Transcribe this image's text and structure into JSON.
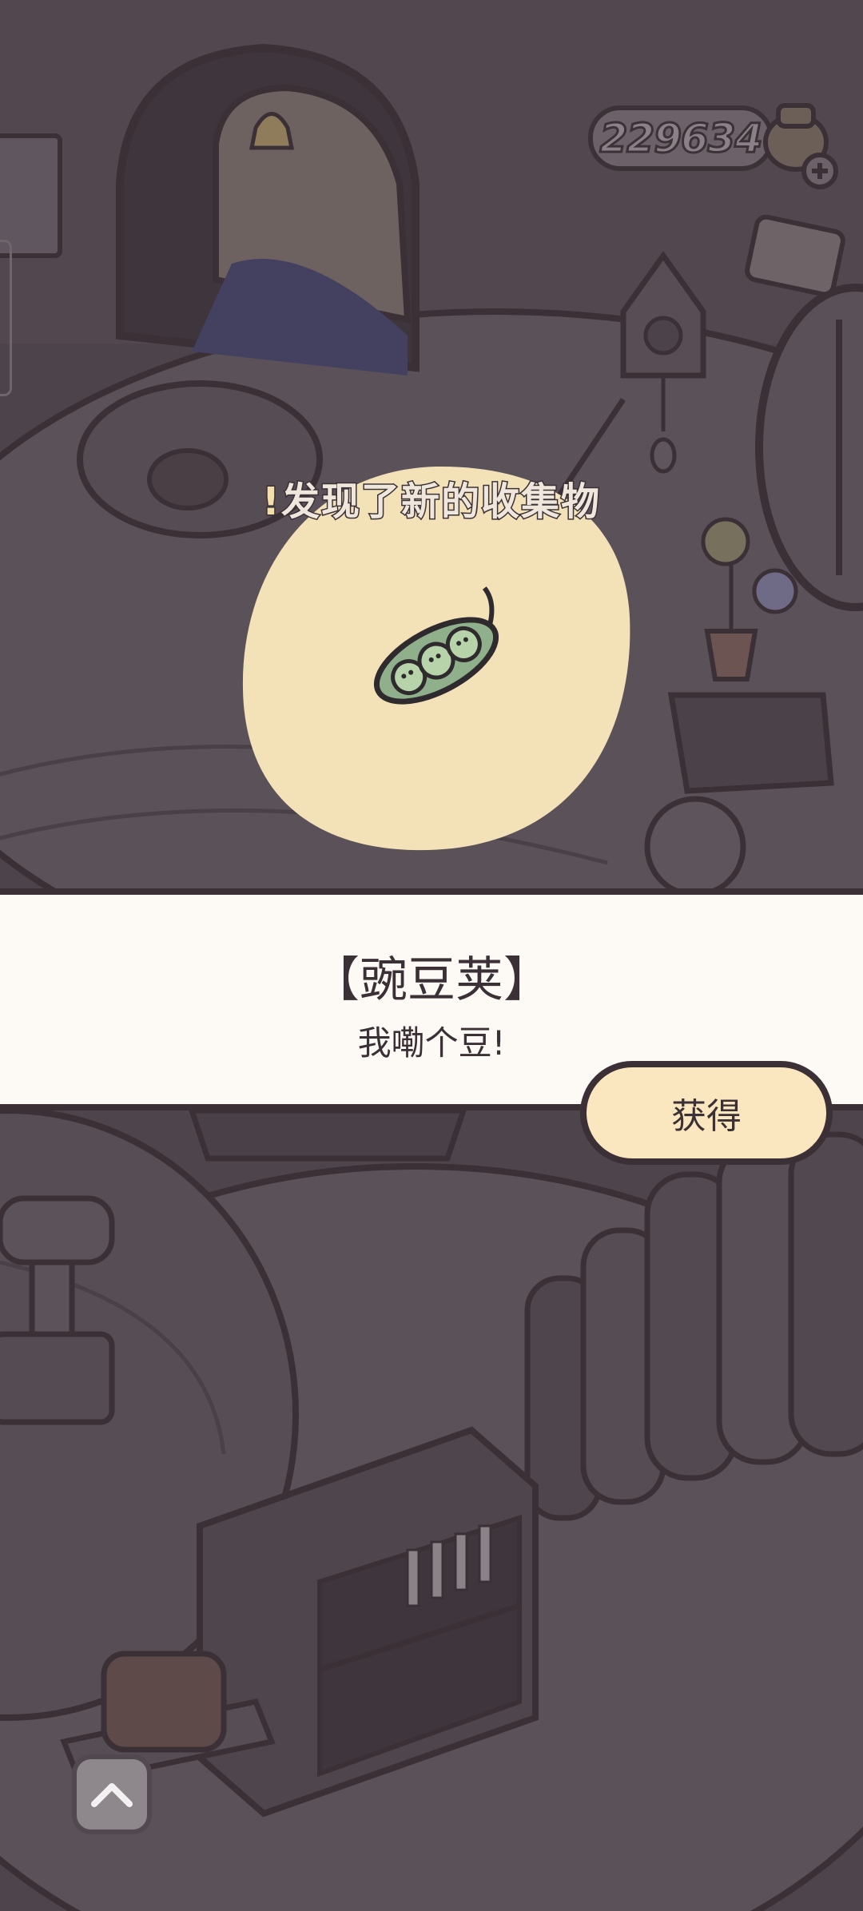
{
  "hud": {
    "coin_count": "229634",
    "add_coins_icon": "plus-icon"
  },
  "popup": {
    "discover_exclaim": "!",
    "discover_text": "发现了新的收集物",
    "item_icon": "pea-pod-icon",
    "item_name": "【豌豆荚】",
    "item_description": "我嘞个豆!",
    "obtain_label": "获得"
  },
  "controls": {
    "scroll_up_icon": "chevron-up-icon"
  },
  "colors": {
    "dim_background": "#4a4047",
    "floor": "#5a5058",
    "outline": "#3a3036",
    "highlight_blob": "#f3e2b8",
    "band": "#fdfaf5",
    "button_fill": "#fae7bf",
    "pea_green": "#8fb08a"
  }
}
